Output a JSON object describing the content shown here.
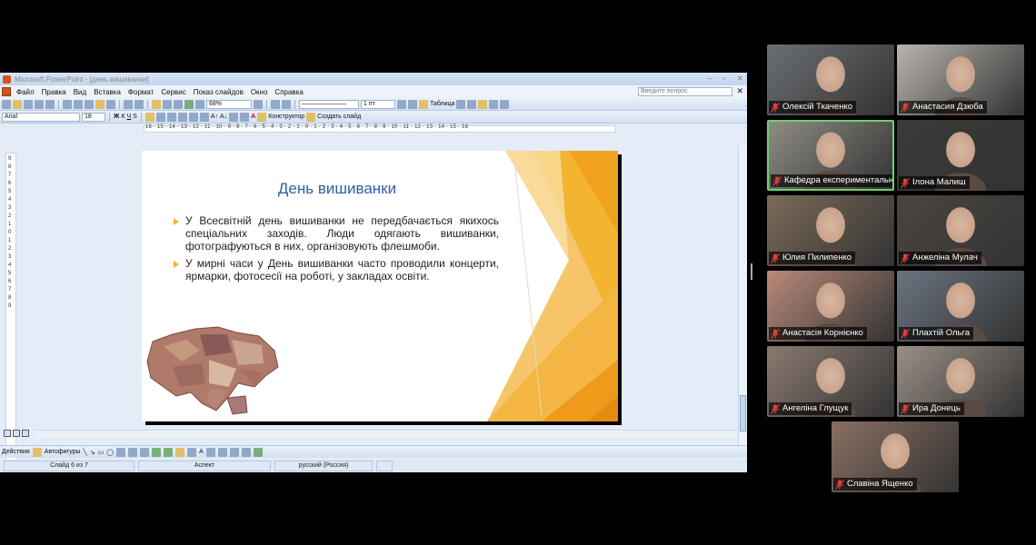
{
  "ppt": {
    "window_title": "Microsoft PowerPoint - [день вишиванки]",
    "menu": [
      "Файл",
      "Правка",
      "Вид",
      "Вставка",
      "Формат",
      "Сервис",
      "Показ слайдов",
      "Окно",
      "Справка"
    ],
    "help_placeholder": "Введите вопрос",
    "zoom": "68%",
    "line_width": "1 пт",
    "table_label": "Таблица",
    "font_name": "Arial",
    "font_size": "18",
    "designer_label": "Конструктор",
    "new_slide_label": "Создать слайд",
    "draw_actions": "Действия",
    "autoshapes": "Автофигуры",
    "ruler_numbers": "16 · 15 · 14 · 13 · 12 · 11 · 10 · 9 · 8 · 7 · 6 · 5 · 4 · 3 · 2 · 1 · 0 · 1 · 2 · 3 · 4 · 5 · 6 · 7 · 8 · 9 · 10 · 11 · 12 · 13 · 14 · 15 · 16",
    "status": {
      "slide": "Слайд 6 из 7",
      "design": "Аспект",
      "language": "русский (Россия)"
    },
    "slide": {
      "title": "День вишиванки",
      "bullets": [
        "У Всесвітній день вишиванки не передбачається якихось спеціальних заходів. Люди одягають вишиванки, фотографуються в них, організовують флешмоби.",
        "У мирні часи у День вишиванки часто проводили концерти, ярмарки, фотосесії на роботі, у закладах освіти."
      ]
    }
  },
  "participants": [
    {
      "name": "Олексій Ткаченко",
      "bg": "#6b6f73"
    },
    {
      "name": "Анастасия Дзюба",
      "bg": "#b9b4ad"
    },
    {
      "name": "Кафедра експериментальн...",
      "bg": "#8f8c84"
    },
    {
      "name": "Ілона Малиш",
      "bg": "#3b3a38"
    },
    {
      "name": "Юлия Пилипенко",
      "bg": "#7a6a58"
    },
    {
      "name": "Анжеліна Мулач",
      "bg": "#4a4540"
    },
    {
      "name": "Анастасія Корнієнко",
      "bg": "#b98a7a"
    },
    {
      "name": "Плахтій Ольга",
      "bg": "#6a7480"
    },
    {
      "name": "Ангеліна Глущук",
      "bg": "#8a7a70"
    },
    {
      "name": "Ира Донець",
      "bg": "#9a8f86"
    },
    {
      "name": "Славіна Ященко",
      "bg": "#8a6f62"
    }
  ]
}
